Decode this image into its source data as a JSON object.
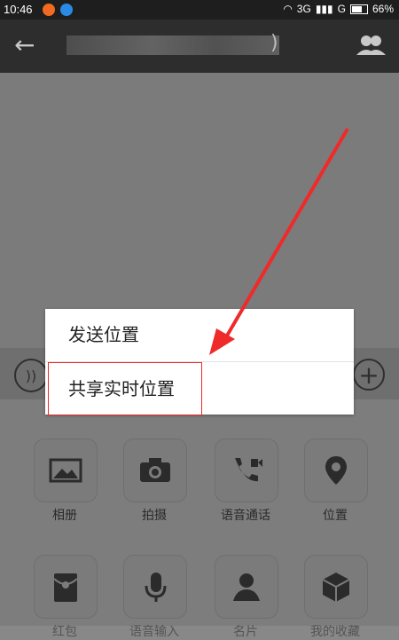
{
  "status_bar": {
    "time": "10:46",
    "network": "3G",
    "signal_suffix": "G",
    "battery": "66%"
  },
  "header": {
    "title_suffix": ")"
  },
  "dialog": {
    "items": [
      {
        "label": "发送位置"
      },
      {
        "label": "共享实时位置"
      }
    ]
  },
  "toolbar": {
    "items": [
      {
        "label": "相册",
        "icon": "photo-album-icon"
      },
      {
        "label": "拍摄",
        "icon": "camera-icon"
      },
      {
        "label": "语音通话",
        "icon": "voice-call-icon"
      },
      {
        "label": "位置",
        "icon": "location-pin-icon"
      },
      {
        "label": "红包",
        "icon": "red-packet-icon"
      },
      {
        "label": "语音输入",
        "icon": "microphone-icon"
      },
      {
        "label": "名片",
        "icon": "contact-card-icon"
      },
      {
        "label": "我的收藏",
        "icon": "favorites-box-icon"
      }
    ]
  },
  "colors": {
    "accent_red": "#ef2a2a",
    "header_bg": "#2d2d2d"
  }
}
